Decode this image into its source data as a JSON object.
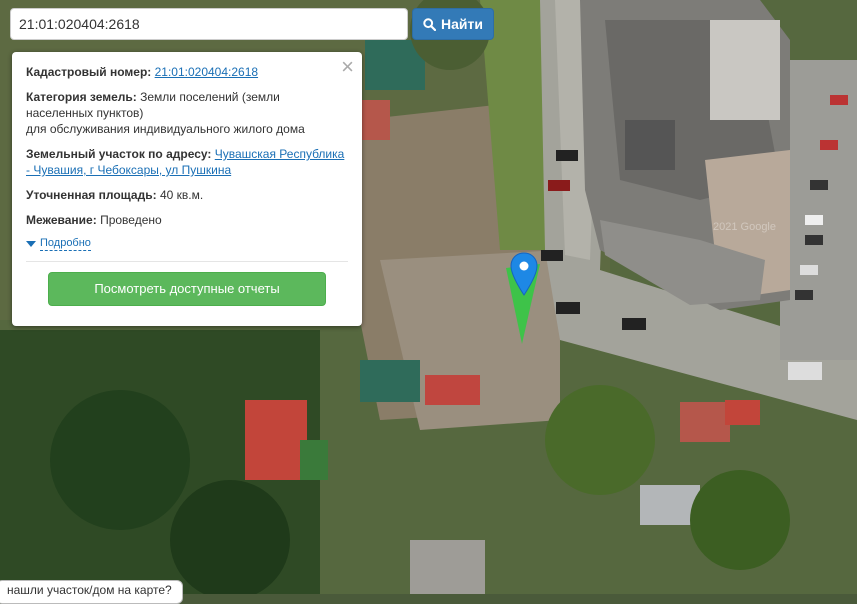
{
  "search": {
    "value": "21:01:020404:2618",
    "button_label": "Найти"
  },
  "popup": {
    "cadastral_label": "Кадастровый номер:",
    "cadastral_number": "21:01:020404:2618",
    "category_label": "Категория земель:",
    "category_line1": "Земли поселений (земли",
    "category_line2": "населенных пунктов)",
    "category_line3": "для обслуживания индивидуального жилого дома",
    "address_label": "Земельный участок по адресу:",
    "address_link_line1": "Чувашская Республика",
    "address_link_line2": "- Чувашия, г Чебоксары, ул Пушкина",
    "area_label": "Уточненная площадь:",
    "area_value": "40 кв.м.",
    "survey_label": "Межевание:",
    "survey_value": "Проведено",
    "more_link": "Подробно",
    "reports_button": "Посмотреть доступные отчеты"
  },
  "map": {
    "copyright": "2021 Google",
    "marker_color": "#1e88e5",
    "parcel_color": "#2ecc40"
  },
  "bottom_hint": "нашли участок/дом на карте?"
}
